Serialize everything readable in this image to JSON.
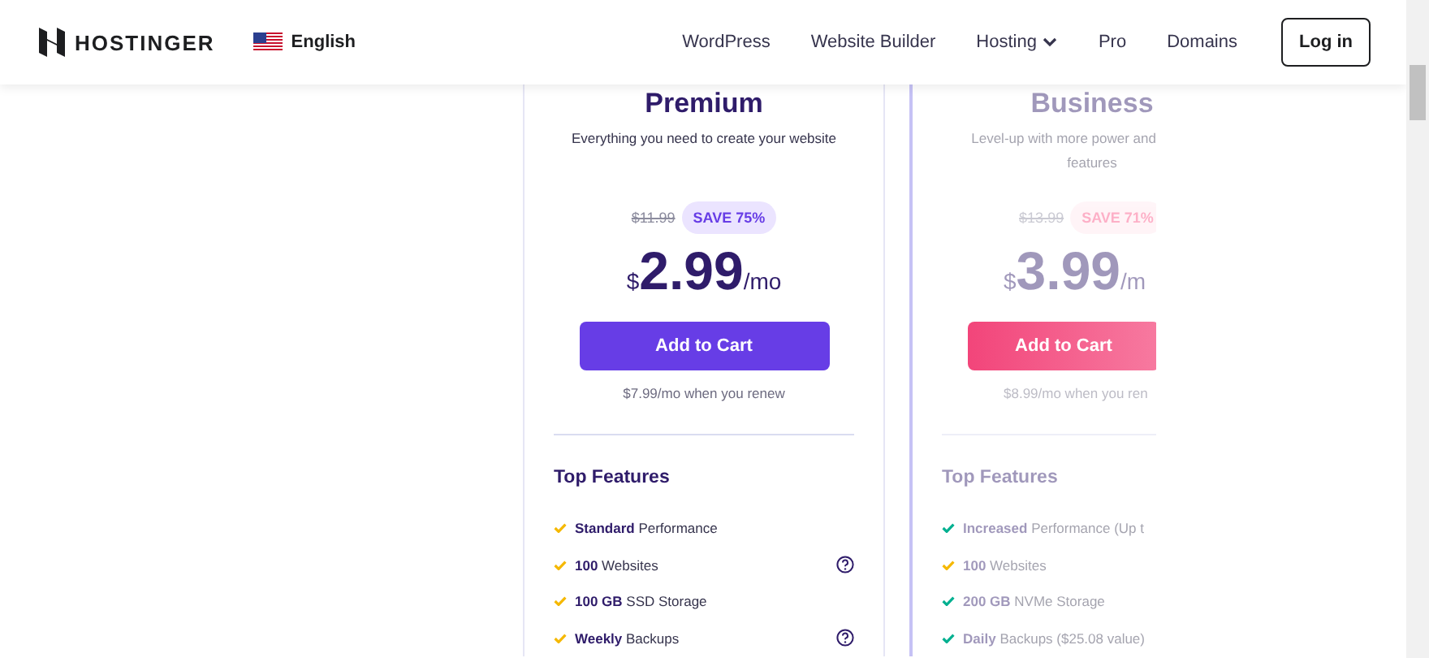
{
  "header": {
    "brand": "HOSTINGER",
    "language": "English",
    "nav": [
      {
        "label": "WordPress",
        "dropdown": false
      },
      {
        "label": "Website Builder",
        "dropdown": false
      },
      {
        "label": "Hosting",
        "dropdown": true
      },
      {
        "label": "Pro",
        "dropdown": false
      },
      {
        "label": "Domains",
        "dropdown": false
      }
    ],
    "login": "Log in"
  },
  "plans": [
    {
      "name": "Premium",
      "faded": false,
      "description": [
        "Everything you need to create your website"
      ],
      "old_price": "$11.99",
      "save": "SAVE 75%",
      "currency": "$",
      "price": "2.99",
      "period": "/mo",
      "button": "Add to Cart",
      "renew": "$7.99/mo when you renew",
      "features_title": "Top Features",
      "features": [
        {
          "text": "**Standard** Performance",
          "color": "#f5b800",
          "help": false
        },
        {
          "text": "**100** Websites",
          "color": "#f5b800",
          "help": true
        },
        {
          "text": "**100 GB** SSD Storage",
          "color": "#f5b800",
          "help": false
        },
        {
          "text": "**Weekly** Backups",
          "color": "#f5b800",
          "help": true
        }
      ]
    },
    {
      "name": "Business",
      "faded": true,
      "description": [
        "Level-up with more power and",
        "features"
      ],
      "old_price": "$13.99",
      "save": "SAVE 71%",
      "currency": "$",
      "price": "3.99",
      "period": "/m",
      "button": "Add to Cart",
      "renew": "$8.99/mo when you ren",
      "features_title": "Top Features",
      "features": [
        {
          "text": "**Increased** Performance (Up t",
          "color": "#00b090",
          "help": false
        },
        {
          "text": "**100** Websites",
          "color": "#f5b800",
          "help": false
        },
        {
          "text": "**200 GB** NVMe Storage",
          "color": "#00b090",
          "help": false
        },
        {
          "text": "**Daily** Backups ($25.08 value)",
          "color": "#00b090",
          "help": false
        }
      ]
    }
  ]
}
